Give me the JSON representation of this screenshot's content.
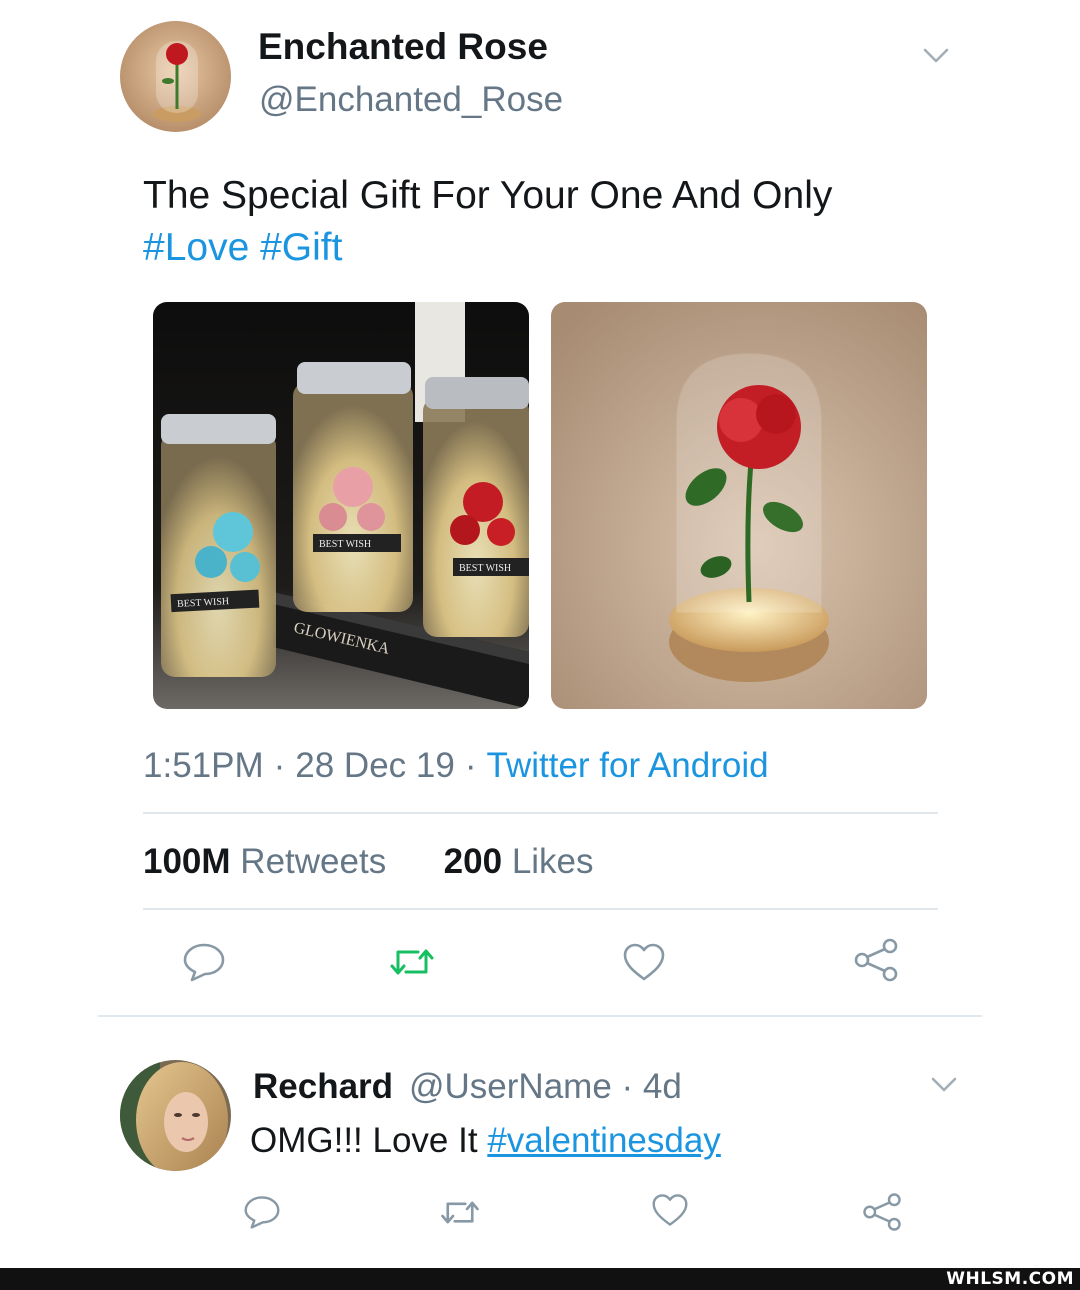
{
  "tweet": {
    "author_name": "Enchanted Rose",
    "author_handle": "@Enchanted_Rose",
    "text": "The Special Gift For Your One And Only",
    "hashtags": [
      "#Love",
      "#Gift"
    ],
    "media": [
      {
        "description": "three lit glass jars with roses",
        "labels": [
          "BEST WISH",
          "BEST WISH",
          "BEST WISH",
          "GLOWIENKA"
        ]
      },
      {
        "description": "red rose under glass dome"
      }
    ],
    "time": "1:51PM",
    "date": "28 Dec 19",
    "source": "Twitter for Android",
    "retweets_count": "100M",
    "retweets_label": "Retweets",
    "likes_count": "200",
    "likes_label": "Likes"
  },
  "reply": {
    "author_name": "Rechard",
    "author_handle": "@UserName",
    "age": "4d",
    "text": "OMG!!! Love It",
    "hashtag": "#valentinesday"
  },
  "watermark": "WHLSM.COM",
  "colors": {
    "link": "#1b95e0",
    "secondary_text": "#657786",
    "retweet_active": "#17bf63",
    "divider": "#e1e8ed"
  },
  "icons": [
    "chevron-down-icon",
    "reply-icon",
    "retweet-icon",
    "like-icon",
    "share-icon"
  ]
}
